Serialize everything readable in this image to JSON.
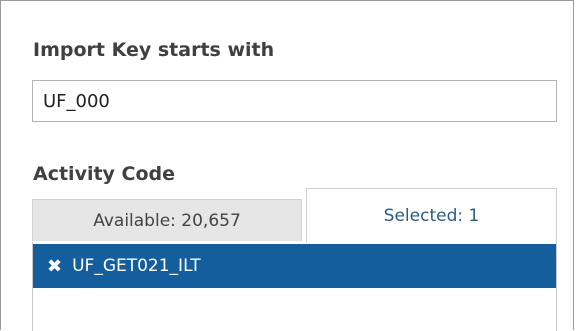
{
  "import_key": {
    "label": "Import Key starts with",
    "value": "UF_000",
    "placeholder": ""
  },
  "activity_code": {
    "label": "Activity Code",
    "tabs": {
      "available": "Available: 20,657",
      "selected": "Selected: 1"
    },
    "active_tab": "selected",
    "selected_items": [
      {
        "remove_icon": "✖",
        "label": "UF_GET021_ILT"
      }
    ]
  },
  "colors": {
    "selected_item_bg": "#145e9e",
    "selected_tab_text": "#2a5c8a",
    "available_tab_bg": "#e6e6e6"
  }
}
